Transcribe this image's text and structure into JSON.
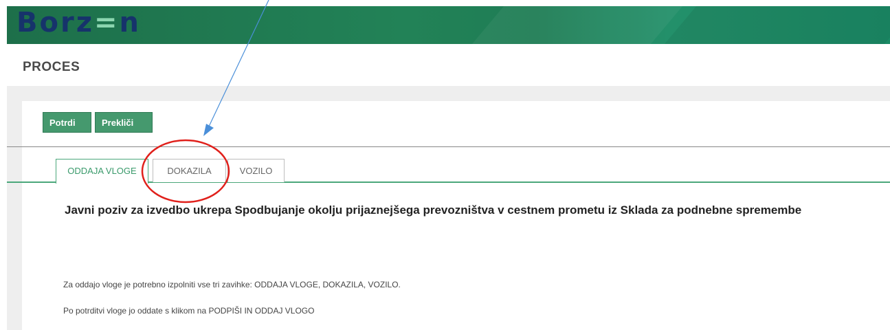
{
  "logo": {
    "text_start": "Borz",
    "text_accent": "=",
    "text_end": "n"
  },
  "page": {
    "title": "PROCES"
  },
  "toolbar": {
    "confirm_label": "Potrdi",
    "cancel_label": "Prekliči"
  },
  "tabs": [
    {
      "label": "ODDAJA VLOGE",
      "active": true
    },
    {
      "label": "DOKAZILA",
      "active": false
    },
    {
      "label": "VOZILO",
      "active": false
    }
  ],
  "content": {
    "heading": "Javni poziv za izvedbo ukrepa Spodbujanje okolju prijaznejšega prevozništva v cestnem prometu iz Sklada za podnebne spremembe",
    "paragraph_1": "Za oddajo vloge je potrebno izpolniti vse tri zavihke: ODDAJA VLOGE, DOKAZILA, VOZILO.",
    "paragraph_2": "Po potrditvi vloge jo oddate s klikom na PODPIŠI IN ODDAJ VLOGO"
  },
  "colors": {
    "brand_green": "#228257",
    "button_green": "#45996e",
    "logo_navy": "#16336b",
    "annotation_red": "#e0201b",
    "annotation_blue": "#4a8fd9"
  }
}
